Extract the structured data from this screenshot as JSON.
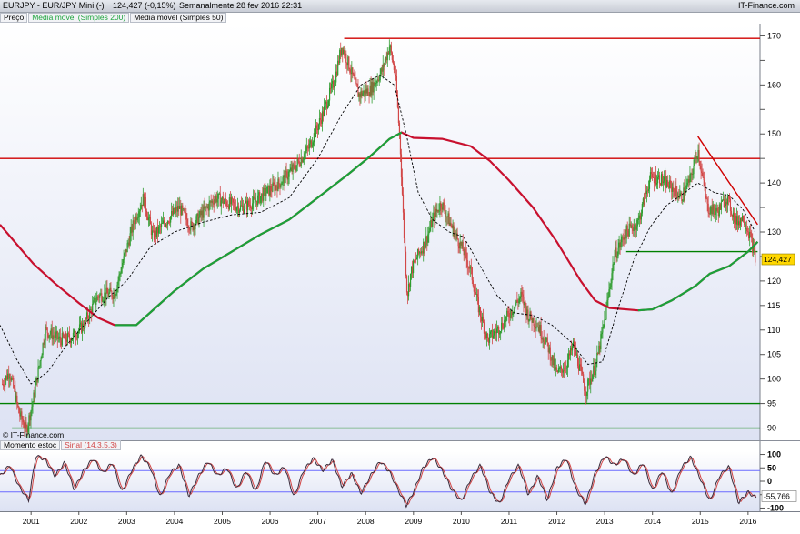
{
  "header": {
    "symbol": "EURJPY - EUR/JPY Mini (-)",
    "quote": "124,427 (-0,15%)",
    "period_date": "Semanalmente   28 fev 2016 22:31",
    "brand": "IT-Finance.com"
  },
  "legend": {
    "price": "Preço",
    "sma200": "Média móvel (Simples 200)",
    "sma50": "Média móvel (Simples 50)"
  },
  "credit": "© IT-Finance.com",
  "stoch_legend": {
    "name": "Momento estoc",
    "signal": "Sinal (14,3,5,3)"
  },
  "colors": {
    "up": "#2e9c2e",
    "down": "#d24747",
    "sma200": "#c8102e",
    "sma50": "#000000",
    "sma_long": "#1aa23a",
    "support": "#008000",
    "resistance": "#d00000",
    "band": "#6a6aff",
    "price_tag": "#ffd700"
  },
  "chart_data": {
    "type": "candlestick",
    "x_axis": {
      "labels": [
        "2001",
        "2002",
        "2003",
        "2004",
        "2005",
        "2006",
        "2007",
        "2008",
        "2009",
        "2010",
        "2011",
        "2012",
        "2013",
        "2014",
        "2015",
        "2016"
      ],
      "range": [
        2000.35,
        2016.25
      ]
    },
    "y_axis": {
      "ticks": [
        90,
        95,
        100,
        105,
        110,
        115,
        120,
        125,
        130,
        135,
        140,
        145,
        150,
        155,
        160,
        165,
        170
      ],
      "labeled": [
        "90",
        "95",
        "100",
        "105",
        "110",
        "115",
        "120",
        "130",
        "140",
        "150",
        "160",
        "170"
      ],
      "range": [
        87.5,
        172.5
      ]
    },
    "last_price": {
      "label": "124,427",
      "value": 124.427
    },
    "price_anchors": [
      [
        2000.4,
        99
      ],
      [
        2000.55,
        101.5
      ],
      [
        2000.75,
        93
      ],
      [
        2000.9,
        89.5
      ],
      [
        2001.05,
        96
      ],
      [
        2001.3,
        110
      ],
      [
        2001.6,
        108
      ],
      [
        2001.85,
        108.5
      ],
      [
        2002.1,
        111
      ],
      [
        2002.4,
        117
      ],
      [
        2002.75,
        117.5
      ],
      [
        2002.9,
        123
      ],
      [
        2003.15,
        132
      ],
      [
        2003.35,
        137
      ],
      [
        2003.55,
        129
      ],
      [
        2003.8,
        132
      ],
      [
        2004.1,
        135
      ],
      [
        2004.35,
        131
      ],
      [
        2004.6,
        134
      ],
      [
        2004.85,
        137
      ],
      [
        2005.1,
        136
      ],
      [
        2005.4,
        135
      ],
      [
        2005.65,
        136
      ],
      [
        2005.9,
        138
      ],
      [
        2006.2,
        140
      ],
      [
        2006.5,
        143
      ],
      [
        2006.8,
        147
      ],
      [
        2007.1,
        154
      ],
      [
        2007.35,
        161
      ],
      [
        2007.5,
        168
      ],
      [
        2007.65,
        164
      ],
      [
        2007.85,
        158
      ],
      [
        2008.1,
        159
      ],
      [
        2008.35,
        163
      ],
      [
        2008.5,
        168
      ],
      [
        2008.62,
        162
      ],
      [
        2008.72,
        148
      ],
      [
        2008.8,
        130
      ],
      [
        2008.87,
        117
      ],
      [
        2008.95,
        122
      ],
      [
        2009.08,
        125
      ],
      [
        2009.25,
        128
      ],
      [
        2009.42,
        133
      ],
      [
        2009.58,
        136
      ],
      [
        2009.8,
        131
      ],
      [
        2010.05,
        126
      ],
      [
        2010.2,
        122
      ],
      [
        2010.35,
        115
      ],
      [
        2010.55,
        108
      ],
      [
        2010.85,
        111
      ],
      [
        2011.05,
        114
      ],
      [
        2011.25,
        117
      ],
      [
        2011.4,
        113
      ],
      [
        2011.6,
        111
      ],
      [
        2011.8,
        107
      ],
      [
        2012.0,
        101
      ],
      [
        2012.2,
        103
      ],
      [
        2012.35,
        107
      ],
      [
        2012.6,
        97.5
      ],
      [
        2012.82,
        103
      ],
      [
        2013.0,
        112
      ],
      [
        2013.2,
        125
      ],
      [
        2013.45,
        130
      ],
      [
        2013.7,
        132
      ],
      [
        2013.95,
        141
      ],
      [
        2014.15,
        141
      ],
      [
        2014.4,
        139
      ],
      [
        2014.6,
        137
      ],
      [
        2014.8,
        141
      ],
      [
        2014.95,
        147
      ],
      [
        2015.15,
        135
      ],
      [
        2015.35,
        134
      ],
      [
        2015.55,
        137
      ],
      [
        2015.75,
        132
      ],
      [
        2015.9,
        133
      ],
      [
        2016.05,
        129
      ],
      [
        2016.15,
        124.4
      ]
    ],
    "sma200_anchors": [
      [
        2000.35,
        131.5
      ],
      [
        2000.7,
        127.5
      ],
      [
        2001.05,
        123.5
      ],
      [
        2001.5,
        119.5
      ],
      [
        2002.0,
        115.5
      ],
      [
        2002.4,
        112.5
      ],
      [
        2002.75,
        111
      ],
      [
        2003.2,
        111
      ],
      [
        2003.6,
        114.5
      ],
      [
        2004.0,
        118
      ],
      [
        2004.6,
        122.5
      ],
      [
        2005.2,
        126
      ],
      [
        2005.8,
        129.5
      ],
      [
        2006.4,
        132.5
      ],
      [
        2007.0,
        137
      ],
      [
        2007.6,
        141.5
      ],
      [
        2008.1,
        145.5
      ],
      [
        2008.5,
        149
      ],
      [
        2008.75,
        150.3
      ],
      [
        2009.0,
        149.2
      ],
      [
        2009.6,
        149
      ],
      [
        2010.2,
        147.5
      ],
      [
        2010.6,
        144.5
      ],
      [
        2011.0,
        140.5
      ],
      [
        2011.5,
        135
      ],
      [
        2012.0,
        128
      ],
      [
        2012.5,
        120
      ],
      [
        2012.8,
        116
      ],
      [
        2013.1,
        114.5
      ],
      [
        2013.7,
        114
      ],
      [
        2014.0,
        114.2
      ],
      [
        2014.4,
        116
      ],
      [
        2014.9,
        119
      ],
      [
        2015.2,
        121.5
      ],
      [
        2015.6,
        123
      ],
      [
        2016.0,
        126
      ],
      [
        2016.2,
        128
      ]
    ],
    "sma_long_anchors": [
      [
        2002.75,
        111
      ],
      [
        2003.2,
        111
      ],
      [
        2003.6,
        114.5
      ],
      [
        2004.0,
        118
      ],
      [
        2004.6,
        122.5
      ],
      [
        2005.2,
        126
      ],
      [
        2005.8,
        129.5
      ],
      [
        2006.4,
        132.5
      ],
      [
        2007.0,
        137
      ],
      [
        2007.6,
        141.5
      ],
      [
        2008.1,
        145.5
      ],
      [
        2008.5,
        149
      ],
      [
        2008.75,
        150.3
      ]
    ],
    "sma50_anchors": [
      [
        2000.35,
        111
      ],
      [
        2000.7,
        104
      ],
      [
        2001.0,
        99
      ],
      [
        2001.35,
        101.5
      ],
      [
        2001.75,
        107
      ],
      [
        2002.2,
        112
      ],
      [
        2002.6,
        116.5
      ],
      [
        2003.0,
        120
      ],
      [
        2003.5,
        127
      ],
      [
        2004.0,
        130
      ],
      [
        2004.6,
        132
      ],
      [
        2005.2,
        133.5
      ],
      [
        2005.8,
        134
      ],
      [
        2006.4,
        137
      ],
      [
        2007.0,
        145
      ],
      [
        2007.5,
        154
      ],
      [
        2007.9,
        160
      ],
      [
        2008.3,
        162
      ],
      [
        2008.6,
        160
      ],
      [
        2008.85,
        150
      ],
      [
        2009.1,
        138
      ],
      [
        2009.4,
        132.5
      ],
      [
        2009.75,
        130
      ],
      [
        2010.05,
        129
      ],
      [
        2010.4,
        123
      ],
      [
        2010.75,
        117
      ],
      [
        2011.1,
        113.5
      ],
      [
        2011.5,
        113
      ],
      [
        2011.9,
        111
      ],
      [
        2012.3,
        107.5
      ],
      [
        2012.65,
        103
      ],
      [
        2012.95,
        103.5
      ],
      [
        2013.3,
        115
      ],
      [
        2013.6,
        124
      ],
      [
        2013.95,
        131
      ],
      [
        2014.3,
        135.5
      ],
      [
        2014.6,
        137.5
      ],
      [
        2014.95,
        140
      ],
      [
        2015.3,
        138
      ],
      [
        2015.6,
        137.5
      ],
      [
        2015.9,
        134.5
      ],
      [
        2016.15,
        130
      ]
    ],
    "horizontal_lines": [
      {
        "kind": "resistance",
        "y": 169.5,
        "x0": 2007.55,
        "x1": 2016.25
      },
      {
        "kind": "resistance",
        "y": 145.0,
        "x0": 2000.35,
        "x1": 2016.25
      },
      {
        "kind": "support",
        "y": 126.0,
        "x0": 2013.45,
        "x1": 2016.2
      },
      {
        "kind": "support",
        "y": 95.0,
        "x0": 2000.35,
        "x1": 2016.25
      },
      {
        "kind": "support",
        "y": 90.0,
        "x0": 2000.6,
        "x1": 2016.25
      }
    ],
    "trendline": {
      "from": [
        2014.95,
        149.5
      ],
      "to": [
        2016.2,
        131.5
      ]
    },
    "stochastic": {
      "y_axis": {
        "ticks": [
          100,
          50,
          0,
          -50,
          -100
        ],
        "labels": [
          "100",
          "50",
          "0",
          "-50",
          "-100"
        ],
        "range": [
          -112,
          112
        ]
      },
      "bands": [
        40,
        -40
      ],
      "last_value": {
        "label": "-55,766",
        "value": -55.766
      },
      "anchors": [
        [
          2000.35,
          20
        ],
        [
          2000.55,
          60
        ],
        [
          2000.75,
          -20
        ],
        [
          2000.95,
          -70
        ],
        [
          2001.1,
          95
        ],
        [
          2001.3,
          80
        ],
        [
          2001.5,
          20
        ],
        [
          2001.7,
          70
        ],
        [
          2001.9,
          -30
        ],
        [
          2002.1,
          40
        ],
        [
          2002.3,
          85
        ],
        [
          2002.5,
          30
        ],
        [
          2002.7,
          70
        ],
        [
          2002.9,
          -40
        ],
        [
          2003.1,
          40
        ],
        [
          2003.3,
          95
        ],
        [
          2003.5,
          50
        ],
        [
          2003.7,
          -60
        ],
        [
          2003.9,
          30
        ],
        [
          2004.1,
          60
        ],
        [
          2004.3,
          -55
        ],
        [
          2004.5,
          20
        ],
        [
          2004.7,
          75
        ],
        [
          2004.9,
          20
        ],
        [
          2005.1,
          50
        ],
        [
          2005.3,
          -30
        ],
        [
          2005.5,
          40
        ],
        [
          2005.7,
          -40
        ],
        [
          2005.9,
          80
        ],
        [
          2006.1,
          20
        ],
        [
          2006.3,
          55
        ],
        [
          2006.5,
          -60
        ],
        [
          2006.7,
          40
        ],
        [
          2006.9,
          85
        ],
        [
          2007.1,
          40
        ],
        [
          2007.3,
          80
        ],
        [
          2007.5,
          -20
        ],
        [
          2007.7,
          30
        ],
        [
          2007.9,
          -45
        ],
        [
          2008.1,
          20
        ],
        [
          2008.3,
          75
        ],
        [
          2008.5,
          35
        ],
        [
          2008.7,
          -40
        ],
        [
          2008.85,
          -90
        ],
        [
          2009.0,
          -40
        ],
        [
          2009.2,
          50
        ],
        [
          2009.4,
          90
        ],
        [
          2009.6,
          40
        ],
        [
          2009.8,
          -30
        ],
        [
          2010.0,
          -75
        ],
        [
          2010.2,
          10
        ],
        [
          2010.4,
          60
        ],
        [
          2010.6,
          -40
        ],
        [
          2010.8,
          -85
        ],
        [
          2011.0,
          10
        ],
        [
          2011.2,
          60
        ],
        [
          2011.4,
          -50
        ],
        [
          2011.6,
          20
        ],
        [
          2011.8,
          -70
        ],
        [
          2012.0,
          50
        ],
        [
          2012.2,
          85
        ],
        [
          2012.4,
          -30
        ],
        [
          2012.6,
          -85
        ],
        [
          2012.8,
          30
        ],
        [
          2013.0,
          95
        ],
        [
          2013.2,
          60
        ],
        [
          2013.4,
          85
        ],
        [
          2013.6,
          20
        ],
        [
          2013.8,
          70
        ],
        [
          2014.0,
          -35
        ],
        [
          2014.2,
          40
        ],
        [
          2014.4,
          -50
        ],
        [
          2014.6,
          50
        ],
        [
          2014.8,
          90
        ],
        [
          2015.0,
          10
        ],
        [
          2015.2,
          -75
        ],
        [
          2015.4,
          20
        ],
        [
          2015.6,
          55
        ],
        [
          2015.8,
          -80
        ],
        [
          2016.0,
          -40
        ],
        [
          2016.15,
          -60
        ]
      ]
    }
  }
}
